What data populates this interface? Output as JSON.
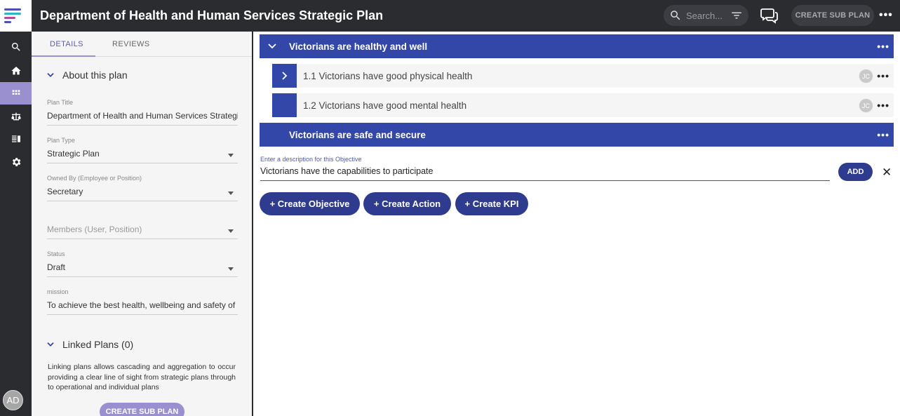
{
  "header": {
    "title": "Department of Health and Human Services Strategic Plan",
    "search_placeholder": "Search...",
    "create_sub_plan_label": "CREATE SUB PLAN",
    "more_label": "•••"
  },
  "rail": {
    "items": [
      "search-icon",
      "home-icon",
      "grid-icon",
      "scales-icon",
      "list-icon",
      "gear-icon"
    ],
    "active_index": 2,
    "avatar_initials": "AD"
  },
  "details": {
    "tabs": [
      {
        "label": "DETAILS",
        "active": true
      },
      {
        "label": "REVIEWS",
        "active": false
      }
    ],
    "about_heading": "About this plan",
    "fields": {
      "plan_title": {
        "label": "Plan Title",
        "value": "Department of Health and Human Services Strategic Plan"
      },
      "plan_type": {
        "label": "Plan Type",
        "value": "Strategic Plan"
      },
      "owned_by": {
        "label": "Owned By (Employee or Position)",
        "value": "Secretary"
      },
      "members": {
        "placeholder": "Members (User, Position)"
      },
      "status": {
        "label": "Status",
        "value": "Draft"
      },
      "mission": {
        "label": "mission",
        "value": "To achieve the best health, wellbeing and safety of all Victorians"
      }
    },
    "linked_heading": "Linked Plans (0)",
    "linked_description": "Linking plans allows cascading and aggregation to occur providing a clear line of sight from strategic plans through to operational and individual plans",
    "create_sub_plan_label": "CREATE SUB PLAN"
  },
  "main": {
    "objectives": [
      {
        "label": "Victorians are healthy and well",
        "expanded": true
      },
      {
        "label": "Victorians are safe and secure",
        "expanded": false
      }
    ],
    "sub_objectives": [
      {
        "label": "1.1 Victorians have good physical health",
        "initials": "JC",
        "has_children": true
      },
      {
        "label": "1.2 Victorians have good mental health",
        "initials": "JC",
        "has_children": false
      }
    ],
    "new_objective": {
      "label": "Enter a description for this Objective",
      "value": "Victorians have the capabilities to participate",
      "add_label": "ADD",
      "close_label": "✕"
    },
    "actions": {
      "create_objective": "+ Create Objective",
      "create_action": "+ Create Action",
      "create_kpi": "+ Create KPI"
    },
    "more_label": "•••"
  },
  "colors": {
    "primary": "#3347a8",
    "dark": "#2b2c30",
    "accent": "#9a8fcf",
    "button": "#2e3b8f"
  }
}
